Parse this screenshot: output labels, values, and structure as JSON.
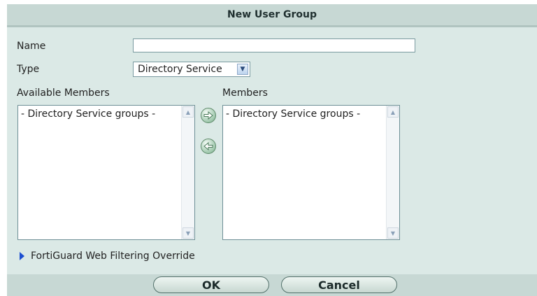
{
  "dialog": {
    "title": "New User Group"
  },
  "form": {
    "name_label": "Name",
    "name_value": "",
    "type_label": "Type",
    "type_value": "Directory Service"
  },
  "available": {
    "label": "Available Members",
    "items": [
      "- Directory Service groups -"
    ]
  },
  "members": {
    "label": "Members",
    "items": [
      "- Directory Service groups -"
    ]
  },
  "transfer": {
    "add_icon": "arrow-right-icon",
    "remove_icon": "arrow-left-icon"
  },
  "fortiguard": {
    "label": "FortiGuard Web Filtering Override",
    "icon": "expand-triangle-icon"
  },
  "buttons": {
    "ok": "OK",
    "cancel": "Cancel"
  },
  "colors": {
    "panel_bg": "#dbe9e6",
    "bar_bg": "#c7d8d4",
    "accent_blue": "#1d4fd1",
    "arrow_green": "#6c9a7b"
  }
}
